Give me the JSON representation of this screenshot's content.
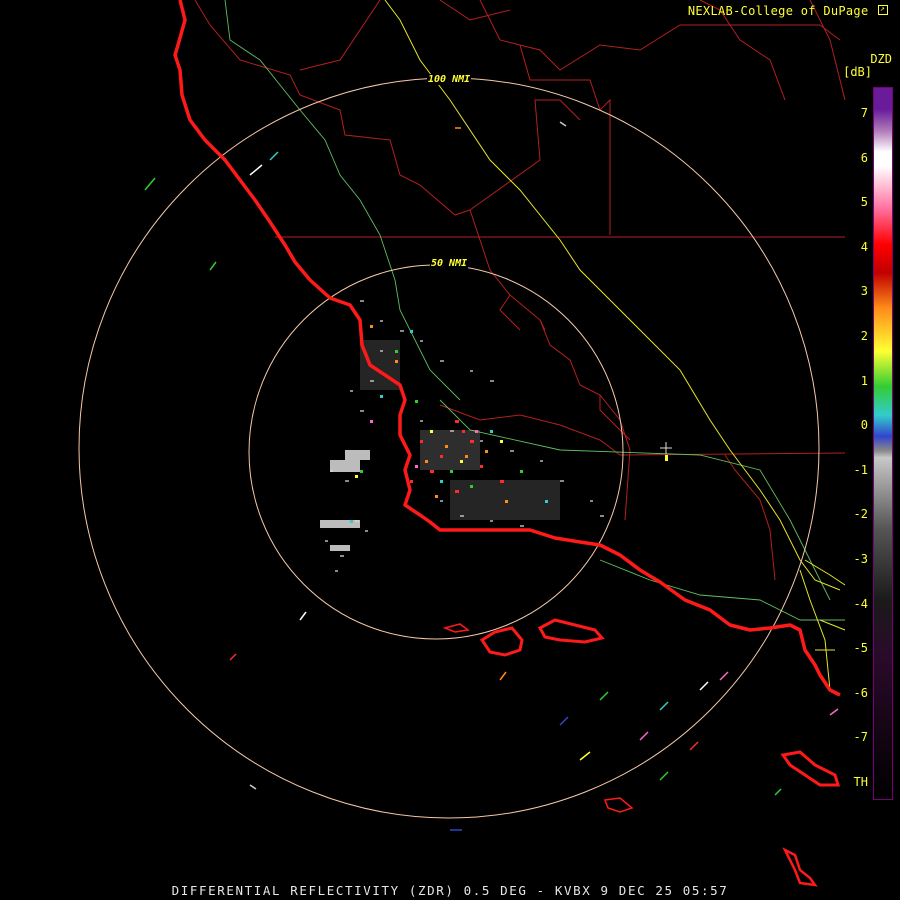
{
  "header": {
    "credit": "NEXLAB-College of DuPage",
    "credit_icon": "external-link-icon"
  },
  "product": {
    "caption": "DIFFERENTIAL REFLECTIVITY (ZDR) 0.5 DEG - KVBX 9 DEC 25 05:57",
    "range_rings": [
      "100 NMI",
      "50 NMI"
    ]
  },
  "legend": {
    "title": "DZD",
    "unit": "[dB]",
    "ticks": [
      "7",
      "6",
      "5",
      "4",
      "3",
      "2",
      "1",
      "0",
      "-1",
      "-2",
      "-3",
      "-4",
      "-5",
      "-6",
      "-7",
      "TH"
    ],
    "colors": {
      "purple": "#6a1b9a",
      "white": "#ffffff",
      "pink": "#ff6fa0",
      "red": "#ff0000",
      "orange": "#ff8c1a",
      "yellow": "#ffff33",
      "green": "#33cc33",
      "cyan": "#33cccc",
      "blue": "#3344cc",
      "gray": "#888888",
      "black": "#000000"
    }
  },
  "map_colors": {
    "coastline": "#ff1a1a",
    "county": "#cc2222",
    "ring": "#f5c9a9",
    "highway": "#ffff33",
    "river": "#66cc66"
  }
}
